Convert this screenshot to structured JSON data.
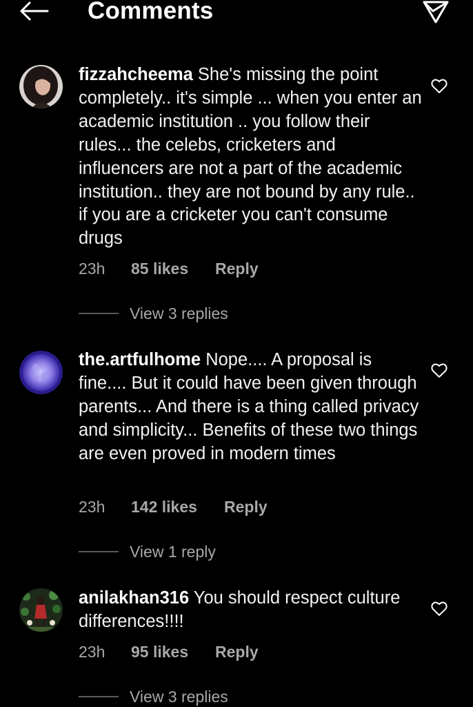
{
  "header": {
    "title": "Comments",
    "back_icon": "arrow-left-icon",
    "share_icon": "send-icon"
  },
  "comments": [
    {
      "username": "fizzahcheema",
      "text": "She's missing the point completely.. it's simple ... when you enter an academic institution .. you follow their rules... the celebs, cricketers and influencers are not a part of the academic institution.. they are not bound by any rule.. if you are a cricketer you can't consume drugs",
      "time": "23h",
      "likes": "85 likes",
      "reply_label": "Reply",
      "view_replies": "View 3 replies"
    },
    {
      "username": "the.artfulhome",
      "text": "Nope.... A proposal is fine.... But it could have been given through parents... And there is a thing called privacy and simplicity... Benefits of these two things are even proved in modern times",
      "time": "23h",
      "likes": "142 likes",
      "reply_label": "Reply",
      "view_replies": "View 1 reply"
    },
    {
      "username": "anilakhan316",
      "text": "You should respect culture differences!!!!",
      "time": "23h",
      "likes": "95 likes",
      "reply_label": "Reply",
      "view_replies": "View 3 replies"
    }
  ],
  "colors": {
    "background": "#000000",
    "text": "#ffffff",
    "meta": "#a8a8a8"
  }
}
